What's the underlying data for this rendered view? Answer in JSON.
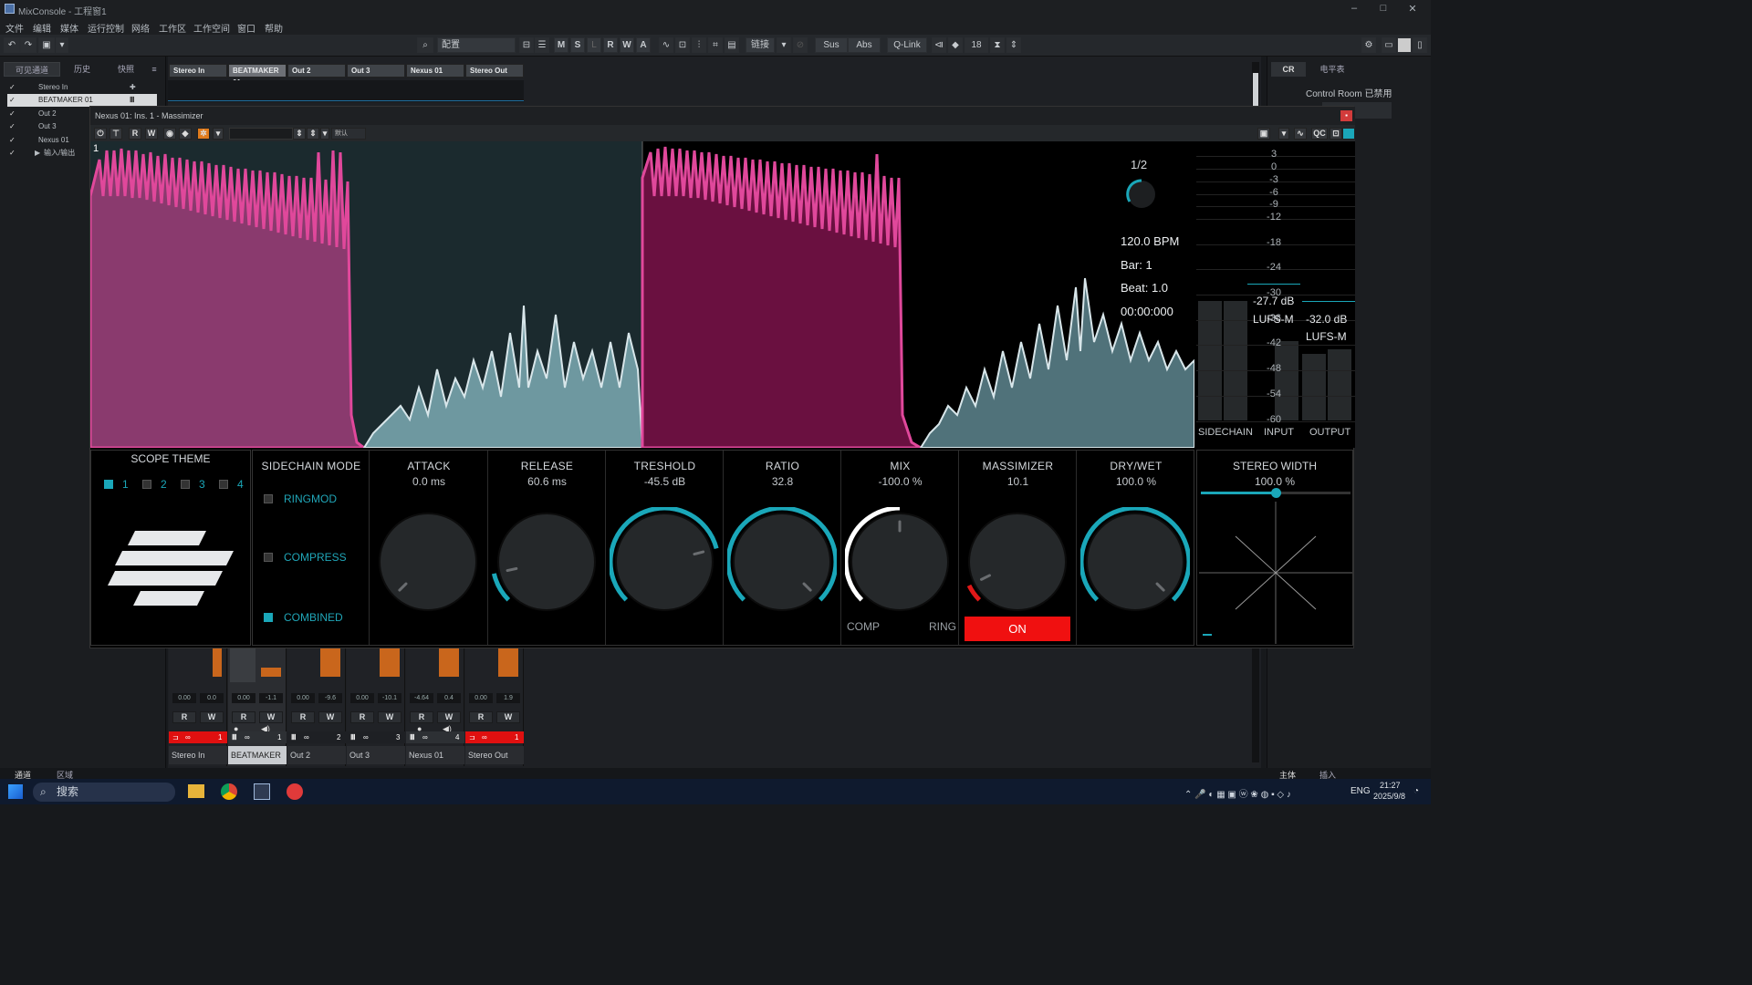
{
  "window": {
    "title": "MixConsole - 工程窗1",
    "controls": [
      "–",
      "□",
      "✕"
    ]
  },
  "menu": [
    "文件",
    "编辑",
    "媒体",
    "运行控制",
    "网络",
    "工作区",
    "工作空间",
    "窗口",
    "帮助"
  ],
  "toolbar": {
    "search_value": "配置",
    "buttons_msl": [
      "M",
      "S",
      "L",
      "R",
      "W",
      "A"
    ],
    "link_label": "链接",
    "sus": "Sus",
    "abs": "Abs",
    "qlink": "Q-Link",
    "zoom": "18"
  },
  "left_panel": {
    "tabs": [
      "可见通道",
      "历史",
      "快照"
    ],
    "channels": [
      {
        "name": "Stereo In",
        "checked": true
      },
      {
        "name": "BEATMAKER 01",
        "checked": true
      },
      {
        "name": "Out 2",
        "checked": true
      },
      {
        "name": "Out 3",
        "checked": true
      },
      {
        "name": "Nexus 01",
        "checked": true
      },
      {
        "name": "输入/输出",
        "checked": true
      }
    ]
  },
  "mixer": {
    "channels": [
      {
        "name": "Stereo In",
        "num": "1",
        "val_a": "0.00",
        "val_b": "0.0"
      },
      {
        "name": "BEATMAKER 01",
        "num": "1",
        "val_a": "0.00",
        "val_b": "-1.1"
      },
      {
        "name": "Out 2",
        "num": "2",
        "val_a": "0.00",
        "val_b": "-9.6"
      },
      {
        "name": "Out 3",
        "num": "3",
        "val_a": "0.00",
        "val_b": "-10.1"
      },
      {
        "name": "Nexus 01",
        "num": "4",
        "val_a": "-4.64",
        "val_b": "0.4"
      },
      {
        "name": "Stereo Out",
        "num": "1",
        "val_a": "0.00",
        "val_b": "1.9"
      }
    ],
    "r_label": "R",
    "w_label": "W"
  },
  "right_panel": {
    "tabs": [
      "CR",
      "电平表"
    ],
    "control_room": "Control Room 已禁用"
  },
  "plugin": {
    "title": "Nexus 01: Ins. 1 - Massimizer",
    "toolbar": {
      "r": "R",
      "w": "W",
      "preset_label": "默认",
      "qc": "QC"
    },
    "scope": {
      "marker_left": "1",
      "division": "1/2",
      "bpm": "120.0 BPM",
      "bar": "Bar: 1",
      "beat": "Beat: 1.0",
      "time": "00:00:000"
    },
    "meters": {
      "scale": [
        "3",
        "0",
        "-3",
        "-6",
        "-9",
        "-12",
        "-18",
        "-24",
        "-30",
        "-36",
        "-42",
        "-48",
        "-54",
        "-60"
      ],
      "lufs_in_value": "-27.7 dB",
      "lufs_in_label": "LUFS-M",
      "lufs_out_value": "-32.0 dB",
      "lufs_out_label": "LUFS-M",
      "labels": [
        "SIDECHAIN",
        "INPUT",
        "OUTPUT"
      ],
      "levels": [
        0.45,
        0.45,
        0.3,
        0.25,
        0.27
      ]
    },
    "scope_theme": {
      "label": "SCOPE THEME",
      "options": [
        "1",
        "2",
        "3",
        "4"
      ],
      "selected": "1"
    },
    "sidechain": {
      "label": "SIDECHAIN MODE",
      "modes": [
        "RINGMOD",
        "COMPRESS",
        "COMBINED"
      ],
      "selected": "COMBINED"
    },
    "knobs": [
      {
        "label": "ATTACK",
        "value": "0.0 ms",
        "fraction": 0.0,
        "color": "#1aa7b9"
      },
      {
        "label": "RELEASE",
        "value": "60.6 ms",
        "fraction": 0.12,
        "color": "#1aa7b9"
      },
      {
        "label": "TRESHOLD",
        "value": "-45.5 dB",
        "fraction": 0.78,
        "color": "#1aa7b9"
      },
      {
        "label": "RATIO",
        "value": "32.8",
        "fraction": 1.0,
        "color": "#1aa7b9"
      },
      {
        "label": "MIX",
        "value": "-100.0 %",
        "fraction": 0.5,
        "color": "#ffffff"
      },
      {
        "label": "MASSIMIZER",
        "value": "10.1",
        "fraction": 0.07,
        "color": "#e01818"
      },
      {
        "label": "DRY/WET",
        "value": "100.0 %",
        "fraction": 1.0,
        "color": "#1aa7b9"
      }
    ],
    "mix_comp": "COMP",
    "mix_ring": "RING",
    "massimizer_button": "ON",
    "stereo": {
      "label": "STEREO WIDTH",
      "value": "100.0 %",
      "fraction": 0.5
    }
  },
  "bottom_tabs": [
    "通道",
    "区域"
  ],
  "right_bottom_tabs": [
    "主体",
    "插入"
  ],
  "taskbar": {
    "search": "搜索",
    "lang": "ENG",
    "time": "21:27",
    "date": "2025/9/8"
  },
  "colors": {
    "accent": "#1aa7b9",
    "pink": "#e0489b",
    "danger": "#f01010",
    "meter_orange": "#c9661c"
  }
}
